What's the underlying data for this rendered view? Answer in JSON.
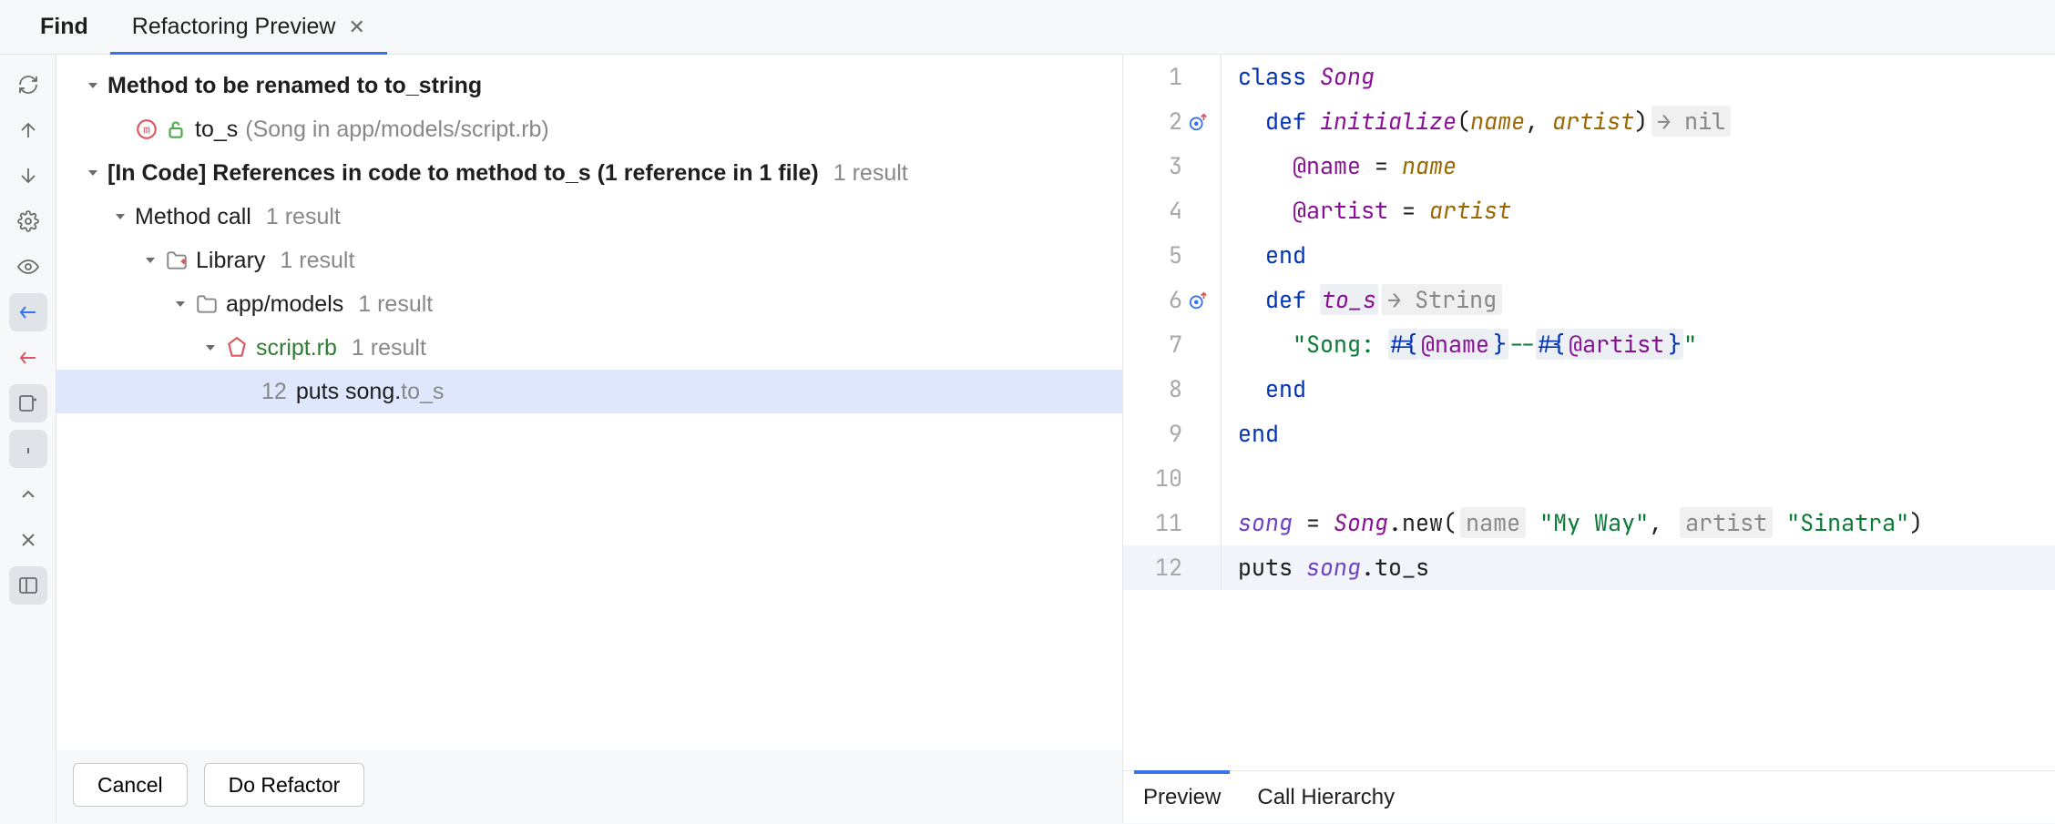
{
  "tabs": {
    "find": "Find",
    "refactoring": "Refactoring Preview"
  },
  "toolbar_icons": [
    "refresh-icon",
    "arrow-up-icon",
    "arrow-down-icon",
    "settings-icon",
    "eye-icon",
    "import-icon",
    "export-icon",
    "new-file-icon",
    "info-icon",
    "expand-icon",
    "collapse-icon",
    "layout-icon"
  ],
  "tree": {
    "header1": {
      "label": "Method to be renamed to to_string"
    },
    "methodrow": {
      "label": "to_s",
      "hint": "(Song in app/models/script.rb)"
    },
    "header2": {
      "label": "[In Code] References in code to method to_s (1 reference in 1 file)",
      "count": "1 result"
    },
    "methodcall": {
      "label": "Method call",
      "count": "1 result"
    },
    "library": {
      "label": "Library",
      "count": "1 result"
    },
    "folder": {
      "label": "app/models",
      "count": "1 result"
    },
    "file": {
      "label": "script.rb",
      "count": "1 result"
    },
    "hit": {
      "linenum": "12",
      "text": "puts song.",
      "suffix": "to_s"
    }
  },
  "buttons": {
    "cancel": "Cancel",
    "do": "Do Refactor"
  },
  "code_lines": [
    {
      "n": 1
    },
    {
      "n": 2,
      "mark": true
    },
    {
      "n": 3
    },
    {
      "n": 4
    },
    {
      "n": 5
    },
    {
      "n": 6,
      "mark": true
    },
    {
      "n": 7
    },
    {
      "n": 8
    },
    {
      "n": 9
    },
    {
      "n": 10
    },
    {
      "n": 11
    },
    {
      "n": 12
    }
  ],
  "hints": {
    "nil": "→ nil",
    "string": "→ String",
    "name": "name",
    "artist": "artist"
  },
  "tokens": {
    "class": "class",
    "Song": "Song",
    "def": "def",
    "initialize": "initialize",
    "p_name": "name",
    "p_artist": "artist",
    "at_name": "@name",
    "at_artist": "@artist",
    "eq": " = ",
    "end": "end",
    "to_s": "to_s",
    "str_lit": "\"Song: ",
    "interp_open": "#{",
    "interp_close": "}",
    "str_mid": "--",
    "str_close": "\"",
    "song": "song",
    "new": ".new(",
    "myway": "\"My Way\"",
    "sinatra": "\"Sinatra\"",
    "comma": ", ",
    "rparen": ")",
    "puts": "puts ",
    "dot_to_s": ".to_s"
  },
  "editor_tabs": {
    "preview": "Preview",
    "callh": "Call Hierarchy"
  }
}
